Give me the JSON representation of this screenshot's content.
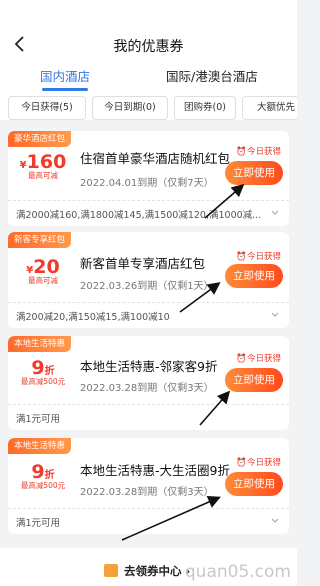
{
  "header": {
    "title": "我的优惠券"
  },
  "tabs": [
    {
      "label": "国内酒店",
      "active": true
    },
    {
      "label": "国际/港澳台酒店",
      "active": false
    }
  ],
  "filters": [
    "今日获得(5)",
    "今日到期(0)",
    "团购券(0)",
    "大额优先"
  ],
  "coupons": [
    {
      "tag": "豪华酒店红包",
      "amount": "160",
      "limit": "最高可减",
      "name": "住宿首单豪华酒店随机红包",
      "date": "2022.04.01到期（仅剩7天）",
      "badge": "今日获得",
      "button": "立即使用",
      "footer": "满2000减160,满1800减145,满1500减120,满1000减..."
    },
    {
      "tag": "新客专享红包",
      "amount": "20",
      "limit": "最高可减",
      "name": "新客首单专享酒店红包",
      "date": "2022.03.26到期（仅剩1天）",
      "badge": "今日获得",
      "button": "立即使用",
      "footer": "满200减20,满150减15,满100减10"
    },
    {
      "tag": "本地生活特惠",
      "amount": "9",
      "unit": "折",
      "limit": "最高减500元",
      "name": "本地生活特惠-邻家客9折",
      "date": "2022.03.28到期（仅剩3天）",
      "badge": "今日获得",
      "button": "立即使用",
      "footer": "满1元可用"
    },
    {
      "tag": "本地生活特惠",
      "amount": "9",
      "unit": "折",
      "limit": "最高减500元",
      "name": "本地生活特惠-大生活圈9折",
      "date": "2022.03.28到期（仅剩3天）",
      "badge": "今日获得",
      "button": "立即使用",
      "footer": "满1元可用"
    }
  ],
  "bottom": {
    "label": "去领券中心",
    "chevron": "›"
  },
  "watermark": "quan05.com",
  "colors": {
    "accent": "#2f79e6",
    "red": "#f03a2a",
    "orange": "#ff6a2b"
  }
}
